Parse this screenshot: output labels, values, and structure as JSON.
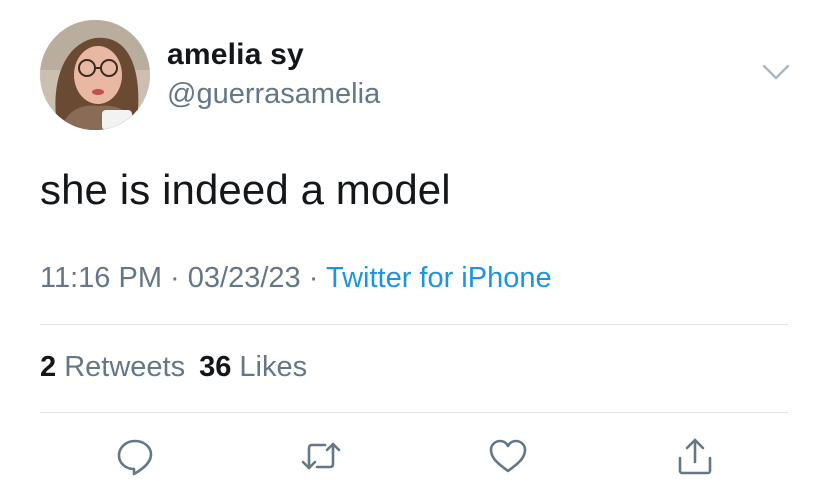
{
  "author": {
    "display_name": "amelia sy",
    "handle": "@guerrasamelia",
    "avatar_icon": "profile-photo"
  },
  "tweet": {
    "text": "she is indeed a model",
    "time": "11:16 PM",
    "separator": "·",
    "date": "03/23/23",
    "source": "Twitter for iPhone"
  },
  "stats": {
    "retweets_count": "2",
    "retweets_label": "Retweets",
    "likes_count": "36",
    "likes_label": "Likes"
  },
  "actions": [
    {
      "icon": "reply-icon"
    },
    {
      "icon": "retweet-icon"
    },
    {
      "icon": "like-icon"
    },
    {
      "icon": "share-icon"
    }
  ],
  "colors": {
    "text": "#14171a",
    "secondary": "#657786",
    "link": "#1b95e0",
    "divider": "#dfe3e6",
    "icon": "#657786"
  }
}
